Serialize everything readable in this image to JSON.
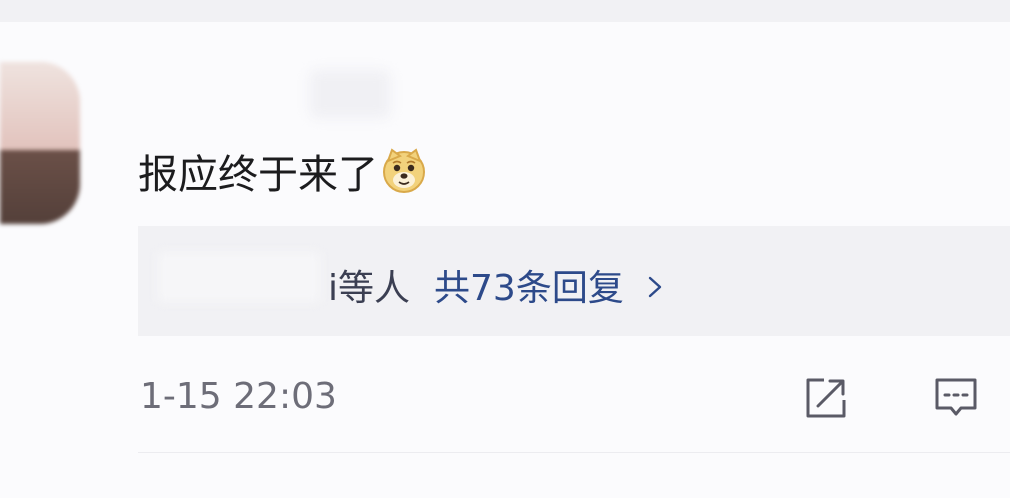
{
  "comment": {
    "text": "报应终于来了",
    "emoji": "doge-icon"
  },
  "replies": {
    "names": "i等人",
    "count_label": "共73条回复",
    "chevron": "chevron-right-icon"
  },
  "meta": {
    "timestamp": "1-15 22:03"
  },
  "actions": {
    "forward_icon": "share-forward-icon",
    "comment_icon": "comment-icon"
  },
  "colors": {
    "background": "#fbfbfd",
    "panel": "#f1f1f4",
    "text": "#1c1c1e",
    "link": "#2d4a8a",
    "muted": "#6d6d78",
    "icon": "#5a5a66"
  }
}
